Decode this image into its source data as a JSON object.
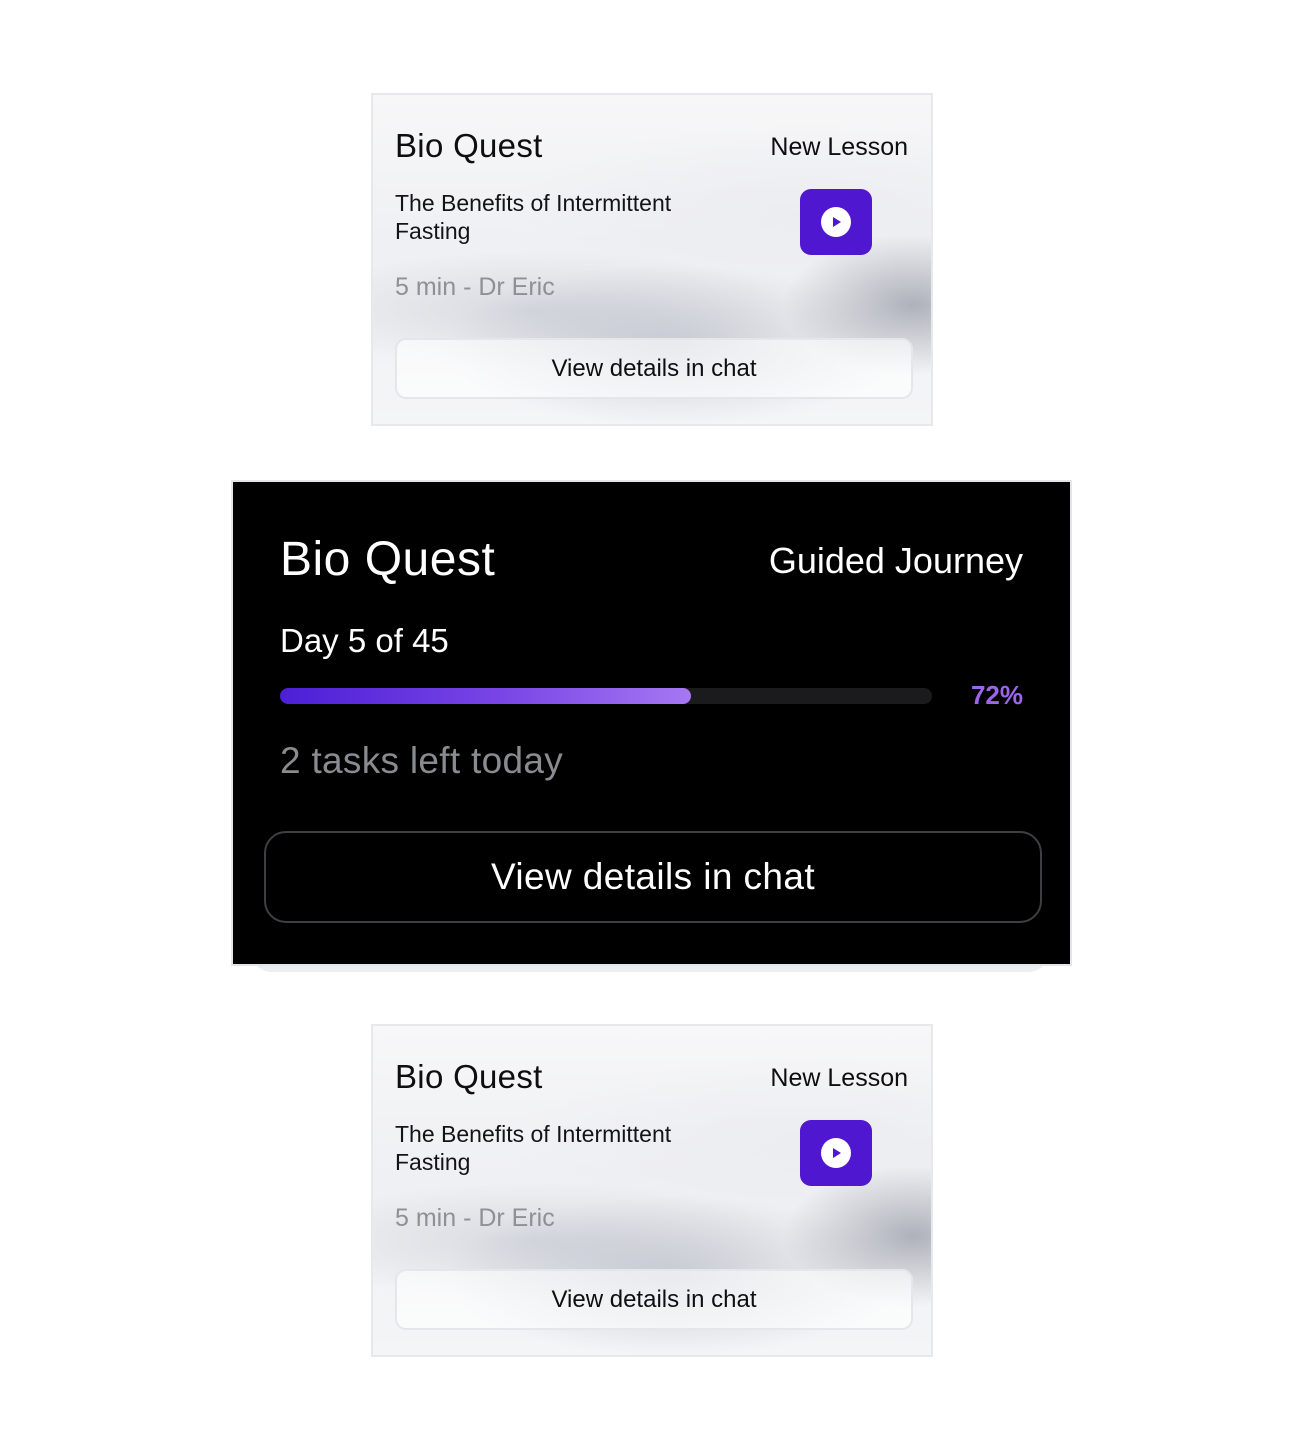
{
  "cards": {
    "top": {
      "title": "Bio Quest",
      "tag": "New Lesson",
      "lesson_title": "The Benefits of Intermittent Fasting",
      "meta": "5 min - Dr Eric",
      "button_label": "View details in chat",
      "play_icon": "play-icon"
    },
    "journey": {
      "title": "Bio Quest",
      "tag": "Guided Journey",
      "day_label": "Day 5 of 45",
      "progress_percent": 63,
      "progress_label": "72%",
      "tasks_label": "2 tasks left today",
      "button_label": "View details in chat"
    },
    "bottom": {
      "title": "Bio Quest",
      "tag": "New Lesson",
      "lesson_title": "The Benefits of Intermittent Fasting",
      "meta": "5 min - Dr Eric",
      "button_label": "View details in chat",
      "play_icon": "play-icon"
    }
  },
  "colors": {
    "accent": "#4f18d0",
    "progress_start": "#4c1fd6",
    "progress_end": "#a678f2",
    "percent_text": "#9b66ea",
    "muted_text": "#8e9096"
  }
}
